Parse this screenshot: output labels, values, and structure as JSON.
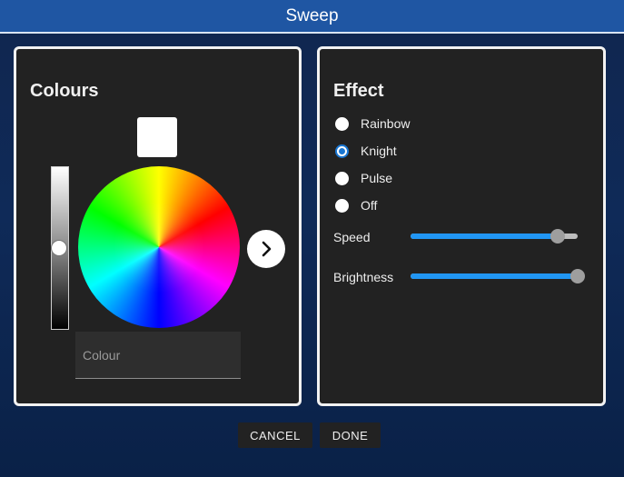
{
  "dialog": {
    "title": "Sweep"
  },
  "colours_panel": {
    "title": "Colours",
    "selected_colour": "#ffffff",
    "lightness": 0.5,
    "colour_input": {
      "value": "",
      "placeholder": "Colour"
    },
    "next_icon": "chevron-right-icon"
  },
  "effect_panel": {
    "title": "Effect",
    "options": [
      {
        "label": "Rainbow",
        "checked": false
      },
      {
        "label": "Knight",
        "checked": true
      },
      {
        "label": "Pulse",
        "checked": false
      },
      {
        "label": "Off",
        "checked": false
      }
    ],
    "speed": {
      "label": "Speed",
      "value": 0.88
    },
    "brightness": {
      "label": "Brightness",
      "value": 1.0
    }
  },
  "buttons": {
    "cancel": "CANCEL",
    "done": "DONE"
  },
  "colors": {
    "titlebar": "#1f56a3",
    "accent": "#2196f3",
    "panel_bg": "#222222"
  }
}
